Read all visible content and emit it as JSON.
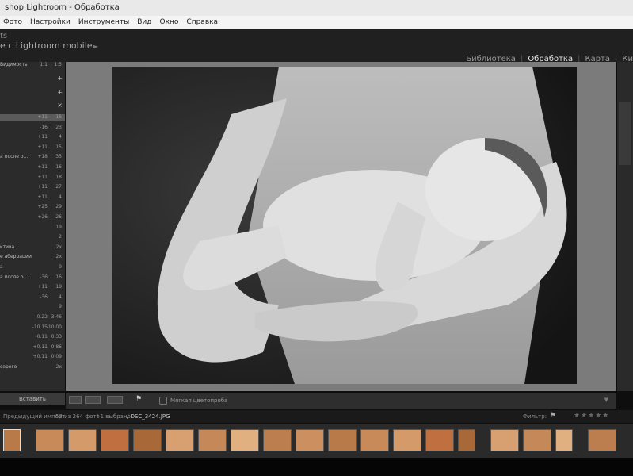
{
  "window": {
    "title": "shop Lightroom - Обработка"
  },
  "menubar": [
    "Фото",
    "Настройки",
    "Инструменты",
    "Вид",
    "Окно",
    "Справка"
  ],
  "identity": {
    "line1": "ts",
    "line2": "е с Lightroom mobile"
  },
  "modules": {
    "library": "Библиотека",
    "develop": "Обработка",
    "map": "Карта",
    "cut": "Ки"
  },
  "left_panel": {
    "top_row": {
      "label": "Видимость",
      "v1": "1:1",
      "v2": "1:5"
    },
    "rows": [
      {
        "label": "",
        "v1": "+11",
        "v2": "16"
      },
      {
        "label": "",
        "v1": "-16",
        "v2": "23"
      },
      {
        "label": "",
        "v1": "+11",
        "v2": "4"
      },
      {
        "label": "",
        "v1": "+11",
        "v2": "15"
      },
      {
        "label": "а после о...",
        "v1": "+18",
        "v2": "35"
      },
      {
        "label": "",
        "v1": "+11",
        "v2": "16"
      },
      {
        "label": "",
        "v1": "+11",
        "v2": "18"
      },
      {
        "label": "",
        "v1": "+11",
        "v2": "27"
      },
      {
        "label": "",
        "v1": "+11",
        "v2": "4"
      },
      {
        "label": "",
        "v1": "+25",
        "v2": "29"
      },
      {
        "label": "",
        "v1": "+26",
        "v2": "26"
      },
      {
        "label": "",
        "v1": "",
        "v2": "19"
      },
      {
        "label": "",
        "v1": "",
        "v2": "2"
      },
      {
        "label": "ктива",
        "v1": "",
        "v2": "2x"
      },
      {
        "label": "е аберрации",
        "v1": "",
        "v2": "2x"
      },
      {
        "label": "а",
        "v1": "",
        "v2": "9"
      },
      {
        "label": "а после о...",
        "v1": "-36",
        "v2": "16"
      },
      {
        "label": "",
        "v1": "+11",
        "v2": "18"
      },
      {
        "label": "",
        "v1": "-36",
        "v2": "4"
      },
      {
        "label": "",
        "v1": "",
        "v2": "9"
      },
      {
        "label": "",
        "v1": "-0.22",
        "v2": "-3.46"
      },
      {
        "label": "",
        "v1": "-10.15",
        "v2": "-10.00"
      },
      {
        "label": "",
        "v1": "-0.11",
        "v2": "0.33"
      },
      {
        "label": "",
        "v1": "+0.11",
        "v2": "0.86"
      },
      {
        "label": "",
        "v1": "+0.11",
        "v2": "0.09"
      },
      {
        "label": "серого",
        "v1": "",
        "v2": "2x"
      }
    ],
    "bottom_button": "Вставить"
  },
  "toolbar": {
    "proof_label": "Мягкая цветопроба"
  },
  "filmstrip_bar": {
    "left": "Предыдущий импорт",
    "count": "53 из 264 фото",
    "selected": "/ 1 выбрано",
    "file": "/ DSC_3424.JPG",
    "filter_label": "Фильтр:"
  },
  "colors": {
    "panel": "#2b2b2b",
    "canvas": "#7b7b7b",
    "active_module": "#e6e6e6",
    "titlebar": "#e9e9e9"
  },
  "icons": [
    "plus-icon",
    "close-icon",
    "view-mode-icon",
    "flag-icon",
    "star-icon",
    "dropdown-icon"
  ]
}
